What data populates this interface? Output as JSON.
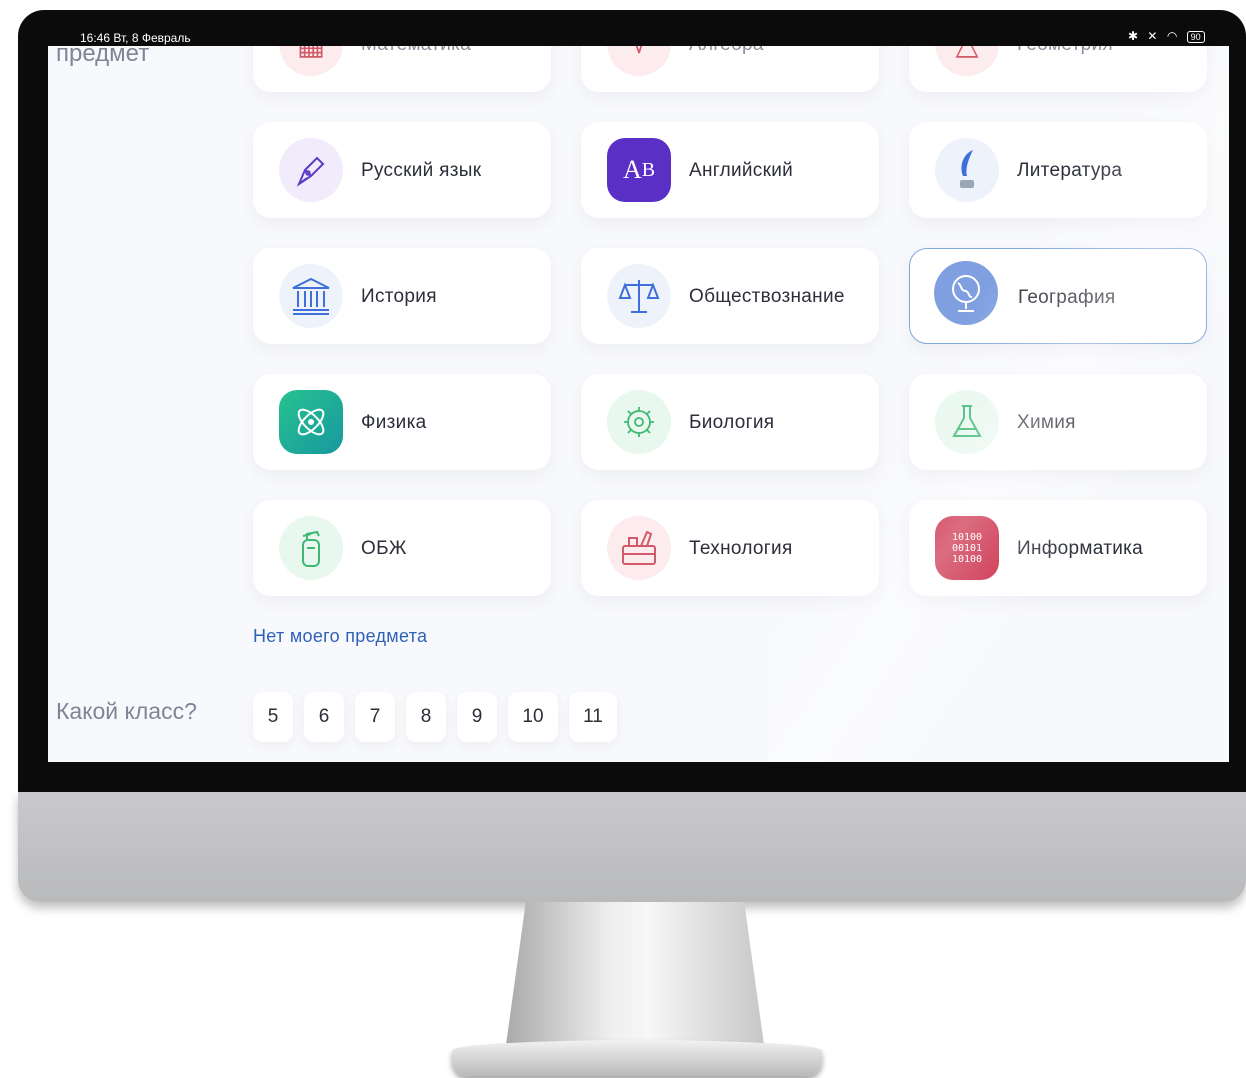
{
  "status_bar": {
    "time": "16:46",
    "date": "Вт, 8 Февраль",
    "battery": "90"
  },
  "section_title": "предмет",
  "top_row": [
    "Математика",
    "Алгебра",
    "Геометрия"
  ],
  "subjects": [
    {
      "label": "Русский язык",
      "icon": "pen-nib-icon"
    },
    {
      "label": "Английский",
      "icon": "ab-letters-icon"
    },
    {
      "label": "Литература",
      "icon": "quill-icon"
    },
    {
      "label": "История",
      "icon": "museum-building-icon"
    },
    {
      "label": "Обществознание",
      "icon": "scales-icon"
    },
    {
      "label": "География",
      "icon": "globe-icon",
      "selected": true
    },
    {
      "label": "Физика",
      "icon": "atom-icon"
    },
    {
      "label": "Биология",
      "icon": "cell-icon"
    },
    {
      "label": "Химия",
      "icon": "flask-icon"
    },
    {
      "label": "ОБЖ",
      "icon": "fire-extinguisher-icon"
    },
    {
      "label": "Технология",
      "icon": "toolbox-icon"
    },
    {
      "label": "Информатика",
      "icon": "binary-code-icon"
    }
  ],
  "informatics_icon_text": [
    "10100",
    "00101",
    "10100"
  ],
  "no_subject_link": "Нет моего предмета",
  "grade_title": "Какой класс?",
  "grades": [
    "5",
    "6",
    "7",
    "8",
    "9",
    "10",
    "11"
  ],
  "colors": {
    "link": "#2f62b7",
    "selected_border": "#7fa7da",
    "english": "#5a2fc6",
    "physics": "#1fa892",
    "informatics": "#c81e3c"
  }
}
